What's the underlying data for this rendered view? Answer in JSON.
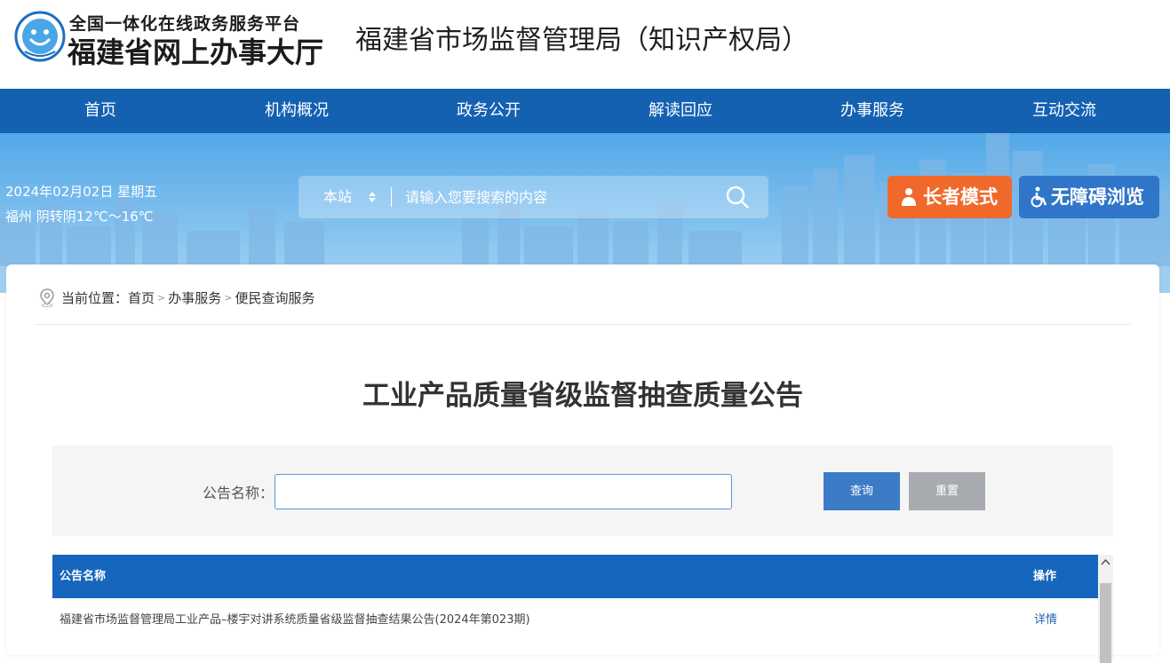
{
  "header": {
    "logo_line1": "全国一体化在线政务服务平台",
    "logo_line2": "福建省网上办事大厅",
    "org_title": "福建省市场监督管理局（知识产权局）"
  },
  "nav": {
    "items": [
      "首页",
      "机构概况",
      "政务公开",
      "解读回应",
      "办事服务",
      "互动交流"
    ]
  },
  "banner": {
    "date": "2024年02月02日 星期五",
    "weather": "福州 阴转阴12℃～16℃",
    "search_scope": "本站",
    "search_placeholder": "请输入您要搜索的内容",
    "elder_mode": "长者模式",
    "accessible": "无障碍浏览"
  },
  "breadcrumb": {
    "prefix": "当前位置：",
    "items": [
      "首页",
      "办事服务",
      "便民查询服务"
    ],
    "separator": ">"
  },
  "page_title": "工业产品质量省级监督抽查质量公告",
  "query": {
    "label": "公告名称：",
    "value": "",
    "search_button": "查询",
    "reset_button": "重置"
  },
  "table": {
    "headers": [
      "公告名称",
      "操作"
    ],
    "rows": [
      {
        "name": "福建省市场监督管理局工业产品–楼宇对讲系统质量省级监督抽查结果公告(2024年第023期)",
        "action": "详情"
      }
    ]
  },
  "colors": {
    "nav_bg": "#1461b2",
    "elder_button": "#f0692a",
    "access_button": "#2f76c9",
    "query_button": "#3c7cc6",
    "reset_button": "#a7aaaf",
    "table_header": "#1666bd"
  }
}
